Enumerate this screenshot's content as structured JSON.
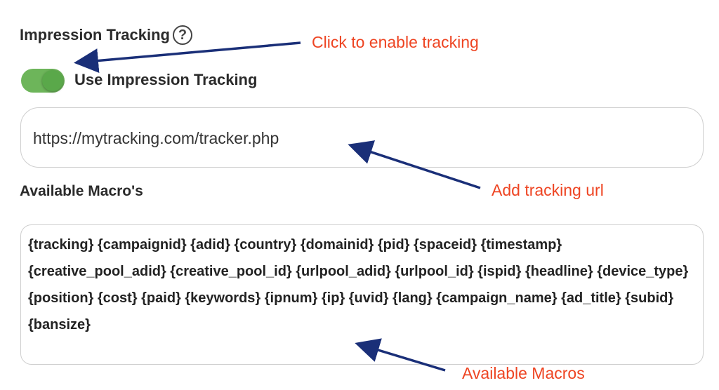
{
  "section": {
    "title": "Impression Tracking",
    "help_icon": "question-circle-icon"
  },
  "toggle": {
    "label": "Use Impression Tracking",
    "state": "on",
    "color": "#6db55a"
  },
  "url_field": {
    "value": "https://mytracking.com/tracker.php"
  },
  "macros": {
    "label": "Available Macro's",
    "text": "{tracking} {campaignid} {adid} {country} {domainid} {pid} {spaceid} {timestamp} {creative_pool_adid} {creative_pool_id} {urlpool_adid} {urlpool_id} {ispid} {headline} {device_type} {position} {cost} {paid} {keywords} {ipnum} {ip} {uvid} {lang} {campaign_name} {ad_title} {subid} {bansize}"
  },
  "annotations": {
    "enable": "Click to enable tracking",
    "url": "Add tracking url",
    "macros": "Available Macros",
    "text_color": "#ee4422",
    "arrow_color": "#1a2f78"
  }
}
